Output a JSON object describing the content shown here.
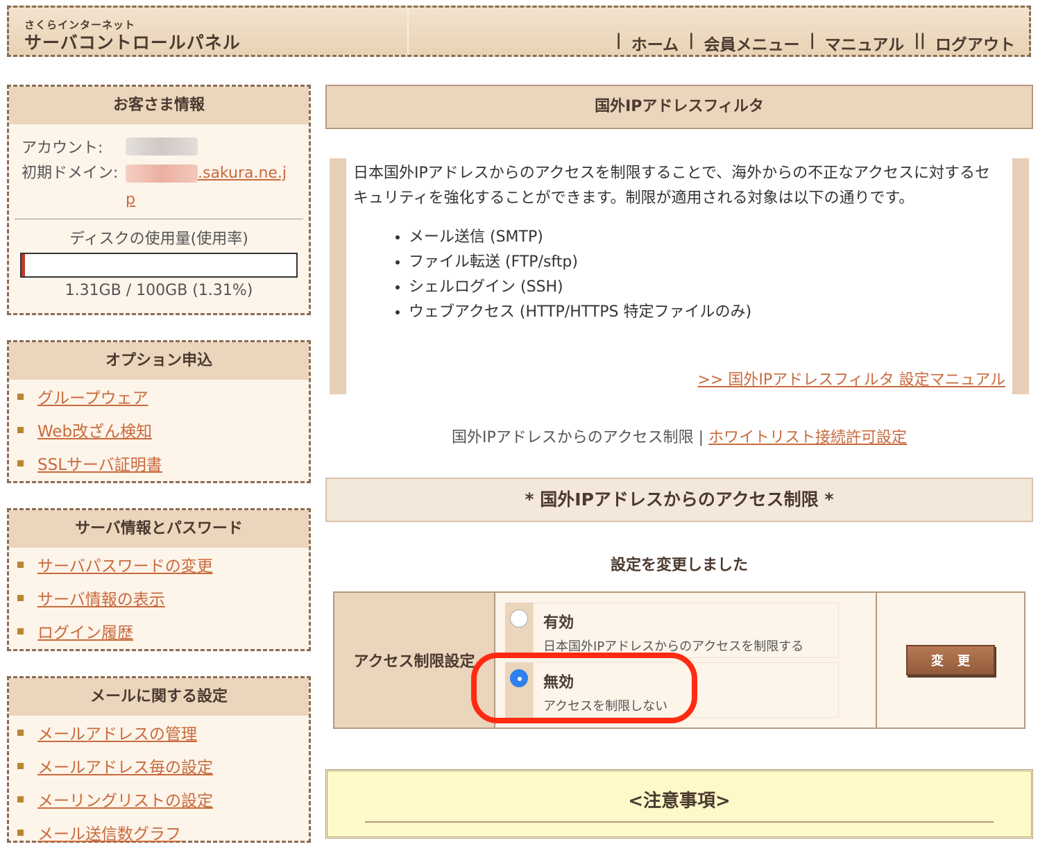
{
  "header": {
    "logo_small": "さくらインターネット",
    "logo_big": "サーバコントロールパネル",
    "nav": [
      {
        "sep": "|",
        "label": "ホーム"
      },
      {
        "sep": "|",
        "label": "会員メニュー"
      },
      {
        "sep": "|",
        "label": "マニュアル"
      },
      {
        "sep": "||",
        "label": "ログアウト"
      }
    ]
  },
  "sidebar": {
    "customer": {
      "title": "お客さま情報",
      "account_label": "アカウント:",
      "domain_label": "初期ドメイン:",
      "domain_suffix": ".sakura.ne.jp",
      "disk_title": "ディスクの使用量(使用率)",
      "disk_usage_fraction": 0.0131,
      "disk_text": "1.31GB / 100GB (1.31%)"
    },
    "options": {
      "title": "オプション申込",
      "items": [
        "グループウェア",
        "Web改ざん検知",
        "SSLサーバ証明書"
      ]
    },
    "server": {
      "title": "サーバ情報とパスワード",
      "items": [
        "サーバパスワードの変更",
        "サーバ情報の表示",
        "ログイン履歴"
      ]
    },
    "mail": {
      "title": "メールに関する設定",
      "items": [
        "メールアドレスの管理",
        "メールアドレス毎の設定",
        "メーリングリストの設定",
        "メール送信数グラフ"
      ]
    }
  },
  "main": {
    "page_title": "国外IPアドレスフィルタ",
    "description": "日本国外IPアドレスからのアクセスを制限することで、海外からの不正なアクセスに対するセキュリティを強化することができます。制限が適用される対象は以下の通りです。",
    "targets": [
      "メール送信 (SMTP)",
      "ファイル転送 (FTP/sftp)",
      "シェルログイン (SSH)",
      "ウェブアクセス (HTTP/HTTPS 特定ファイルのみ)"
    ],
    "manual_link": ">> 国外IPアドレスフィルタ 設定マニュアル",
    "subnav_current": "国外IPアドレスからのアクセス制限",
    "subnav_sep": "|",
    "subnav_link": "ホワイトリスト接続許可設定",
    "section_title": "* 国外IPアドレスからのアクセス制限 *",
    "status_message": "設定を変更しました",
    "setting": {
      "label": "アクセス制限設定",
      "options": [
        {
          "title": "有効",
          "desc": "日本国外IPアドレスからのアクセスを制限する",
          "checked": false
        },
        {
          "title": "無効",
          "desc": "アクセスを制限しない",
          "checked": true
        }
      ],
      "button": "変更"
    },
    "notice_title": "<注意事項>"
  },
  "colors": {
    "accent_link": "#c86a3c",
    "highlight": "#ff2a12",
    "radio_checked": "#2f80ed"
  }
}
